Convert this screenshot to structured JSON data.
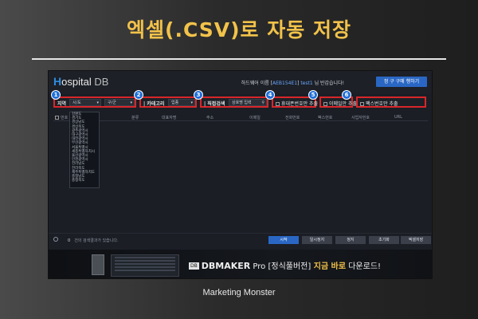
{
  "slide": {
    "title": "엑셀(.CSV)로 자동 저장",
    "footer": "Marketing Monster"
  },
  "app": {
    "logo_h": "H",
    "logo_rest": "ospital",
    "logo_db": "DB",
    "header_msg_prefix": "하드웨어 이름 [",
    "header_msg_id": "AEB154E1",
    "header_msg_mid": "] ",
    "header_msg_user": "test1",
    "header_msg_suffix": " 님 반갑습니다!",
    "buy_button": "정 구 구매 행하기",
    "filters": {
      "region_label": "지역",
      "region_sel1": "시/도",
      "region_sel2": "구/군",
      "category_label": "카테고리",
      "category_sel": "업종",
      "direct_label": "직접검색",
      "direct_placeholder": "상호명 입력",
      "opt1": "휴대폰번호만 추출",
      "opt2": "이메일만 추출",
      "opt3": "팩스번호만 추출"
    },
    "badges": [
      "1",
      "2",
      "3",
      "4",
      "5",
      "6"
    ],
    "columns": [
      "번호",
      "분류",
      "대표자명",
      "주소",
      "이메일",
      "전화번호",
      "팩스번호",
      "사업자번호",
      "URL"
    ],
    "dropdown_items": [
      "강원도",
      "경기도",
      "경상남도",
      "경상북도",
      "광주광역시",
      "대구광역시",
      "대전광역시",
      "부산광역시",
      "서울특별시",
      "세종특별자치시",
      "울산광역시",
      "인천광역시",
      "전라남도",
      "전라북도",
      "제주특별자치도",
      "충청남도",
      "충청북도"
    ],
    "status_count": "0",
    "status_text": "건의 검색결과가 있습니다.",
    "buttons": {
      "start": "시작",
      "pause": "일시정지",
      "stop": "정지",
      "reset": "초기화",
      "excel": "엑셀저장"
    },
    "banner": {
      "db_icon": "DB",
      "product": "DBMAKER",
      "product_sub": " Pro ",
      "edition": "[정식풀버전]",
      "cta_bold": " 지금 바로",
      "cta_rest": " 다운로드!"
    }
  },
  "colors": {
    "title": "#f2c24a",
    "highlight_box": "#d9262a",
    "badge": "#1e6fd9",
    "primary_button": "#2a67c4"
  }
}
